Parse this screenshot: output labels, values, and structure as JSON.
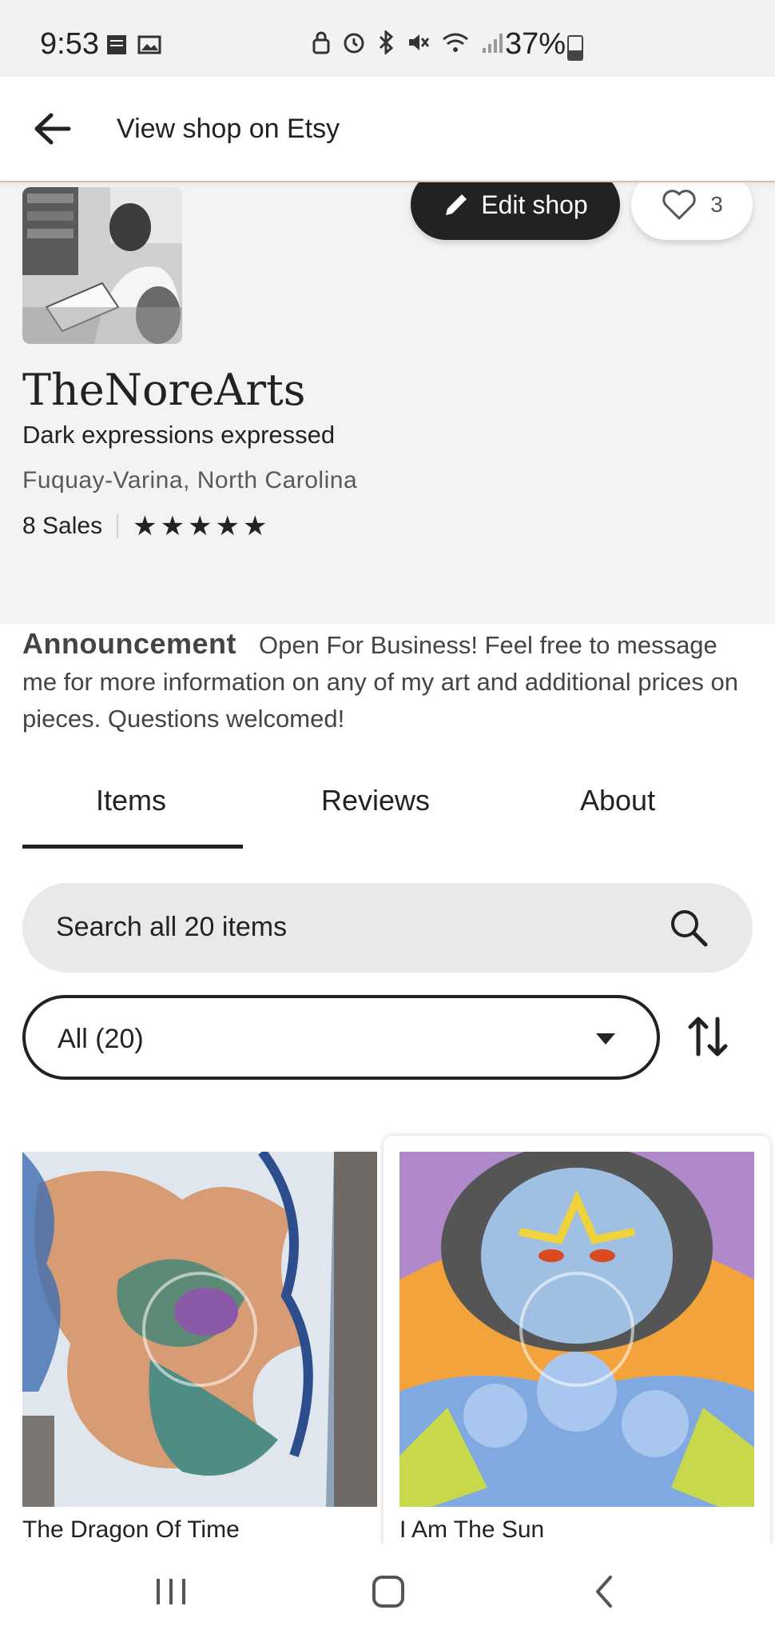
{
  "status_bar": {
    "time": "9:53",
    "battery": "37%",
    "icons": [
      "sim-icon",
      "image-icon",
      "lock-icon",
      "alarm-icon",
      "bluetooth-icon",
      "mute-icon",
      "wifi-icon",
      "signal-icon",
      "battery-icon"
    ]
  },
  "top_bar": {
    "title": "View shop on Etsy",
    "back_icon": "arrow-left-icon"
  },
  "shop": {
    "edit_label": "Edit shop",
    "favorites_count": "3",
    "name": "TheNoreArts",
    "tagline": "Dark expressions expressed",
    "location": "Fuquay-Varina, North Carolina",
    "sales": "8 Sales",
    "rating_stars": 5
  },
  "announcement": {
    "label": "Announcement",
    "text": "Open For Business! Feel free to message me for more information on any of my art and additional prices on pieces. Questions welcomed!"
  },
  "tabs": {
    "items": "Items",
    "reviews": "Reviews",
    "about": "About",
    "active": "Items"
  },
  "search": {
    "placeholder": "Search all 20 items"
  },
  "filter": {
    "selected": "All (20)"
  },
  "listings": [
    {
      "title": "The Dragon Of Time"
    },
    {
      "title": "I Am The Sun"
    }
  ],
  "colors": {
    "accent_dark": "#222222",
    "page_bg": "#f4f3f3",
    "search_bg": "#e9e9e9"
  }
}
